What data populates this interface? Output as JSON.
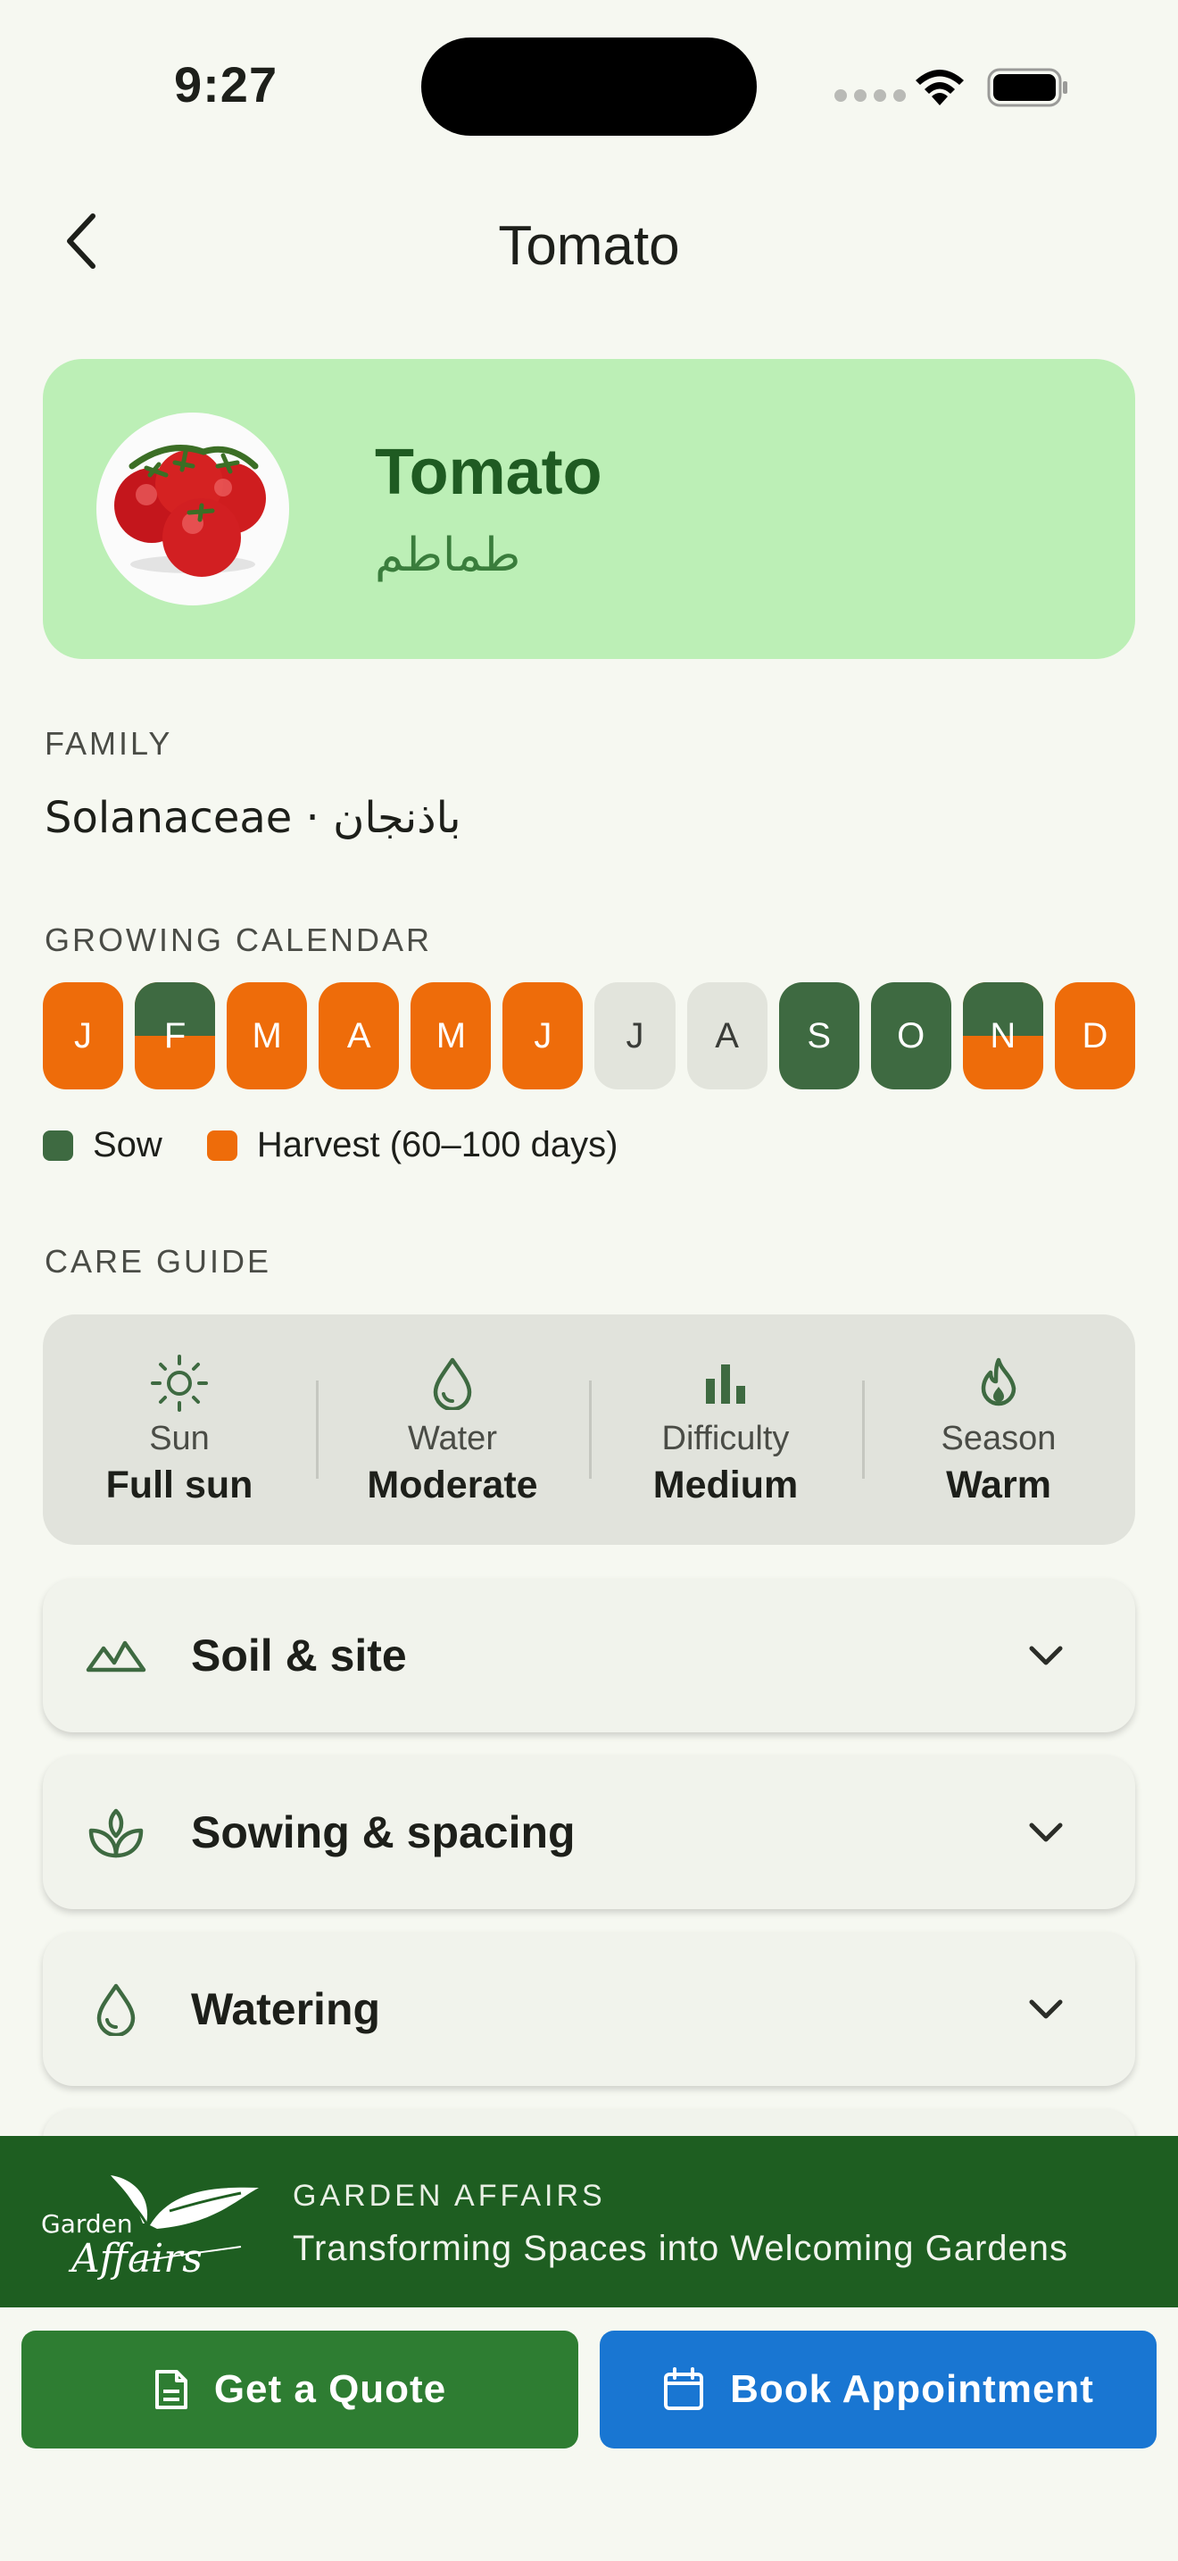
{
  "status": {
    "time": "9:27"
  },
  "nav": {
    "title": "Tomato",
    "back_icon": "chevron-left-icon"
  },
  "hero": {
    "name": "Tomato",
    "alt_name": "طماطم",
    "photo": "tomato-photo"
  },
  "family": {
    "label": "FAMILY",
    "value": "Solanaceae · باذنجان"
  },
  "calendar": {
    "label": "GROWING CALENDAR",
    "months": [
      {
        "letter": "J",
        "state": "harvest"
      },
      {
        "letter": "F",
        "state": "sow-harvest"
      },
      {
        "letter": "M",
        "state": "harvest"
      },
      {
        "letter": "A",
        "state": "harvest"
      },
      {
        "letter": "M",
        "state": "harvest"
      },
      {
        "letter": "J",
        "state": "harvest"
      },
      {
        "letter": "J",
        "state": "none"
      },
      {
        "letter": "A",
        "state": "none"
      },
      {
        "letter": "S",
        "state": "sow"
      },
      {
        "letter": "O",
        "state": "sow"
      },
      {
        "letter": "N",
        "state": "sow-harvest"
      },
      {
        "letter": "D",
        "state": "harvest"
      }
    ],
    "legend": {
      "sow": "Sow",
      "harvest": "Harvest (60–100 days)"
    },
    "colors": {
      "sow": "#3e6a41",
      "harvest": "#ee6c0a",
      "none": "#e2e4dc"
    }
  },
  "care": {
    "label": "CARE GUIDE",
    "items": [
      {
        "key": "Sun",
        "value": "Full sun",
        "icon": "sun-icon"
      },
      {
        "key": "Water",
        "value": "Moderate",
        "icon": "water-drop-icon"
      },
      {
        "key": "Difficulty",
        "value": "Medium",
        "icon": "bar-chart-icon"
      },
      {
        "key": "Season",
        "value": "Warm",
        "icon": "flame-icon"
      }
    ]
  },
  "sections": [
    {
      "title": "Soil & site",
      "icon": "landscape-icon"
    },
    {
      "title": "Sowing & spacing",
      "icon": "sprout-icon"
    },
    {
      "title": "Watering",
      "icon": "water-drop-icon"
    }
  ],
  "banner": {
    "kicker": "GARDEN AFFAIRS",
    "tagline": "Transforming Spaces into Welcoming Gardens",
    "logo_text": "Garden Affairs"
  },
  "cta": {
    "quote": "Get a Quote",
    "book": "Book Appointment"
  },
  "theme": {
    "primary": "#2e7d32",
    "secondary": "#1976d2",
    "hero_bg": "#bcefb6",
    "dark_green": "#1e5e21"
  }
}
